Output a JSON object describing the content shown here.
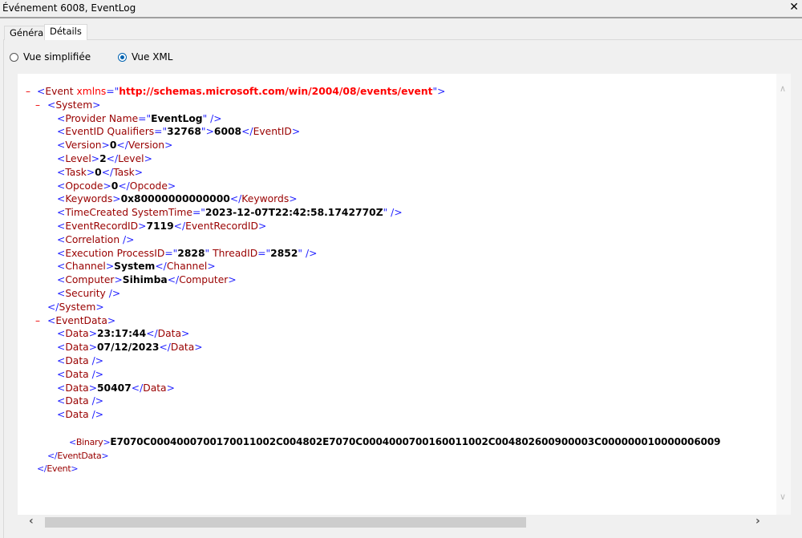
{
  "window": {
    "title": "Événement 6008, EventLog",
    "close_icon": "close-icon"
  },
  "tabs": [
    {
      "label": "Général",
      "active": false
    },
    {
      "label": "Détails",
      "active": true
    }
  ],
  "view_options": [
    {
      "label": "Vue simplifiée",
      "selected": false
    },
    {
      "label": "Vue XML",
      "selected": true
    }
  ],
  "xml": {
    "lines": [
      {
        "indent": 0,
        "collapse": true,
        "tokens": [
          [
            "p",
            "<"
          ],
          [
            "t",
            "Event "
          ],
          [
            "xa",
            "xmlns"
          ],
          [
            "p",
            "=\""
          ],
          [
            "xv",
            "http://schemas.microsoft.com/win/2004/08/events/event"
          ],
          [
            "p",
            "\">"
          ]
        ]
      },
      {
        "indent": 1,
        "collapse": true,
        "tokens": [
          [
            "p",
            "<"
          ],
          [
            "t",
            "System"
          ],
          [
            "p",
            ">"
          ]
        ]
      },
      {
        "indent": 2,
        "tokens": [
          [
            "p",
            "<"
          ],
          [
            "t",
            "Provider "
          ],
          [
            "a",
            "Name"
          ],
          [
            "p",
            "=\""
          ],
          [
            "v",
            "EventLog"
          ],
          [
            "p",
            "\" />"
          ]
        ]
      },
      {
        "indent": 2,
        "tokens": [
          [
            "p",
            "<"
          ],
          [
            "t",
            "EventID "
          ],
          [
            "a",
            "Qualifiers"
          ],
          [
            "p",
            "=\""
          ],
          [
            "v",
            "32768"
          ],
          [
            "p",
            "\">"
          ],
          [
            "x",
            "6008"
          ],
          [
            "p",
            "</"
          ],
          [
            "t",
            "EventID"
          ],
          [
            "p",
            ">"
          ]
        ]
      },
      {
        "indent": 2,
        "tokens": [
          [
            "p",
            "<"
          ],
          [
            "t",
            "Version"
          ],
          [
            "p",
            ">"
          ],
          [
            "x",
            "0"
          ],
          [
            "p",
            "</"
          ],
          [
            "t",
            "Version"
          ],
          [
            "p",
            ">"
          ]
        ]
      },
      {
        "indent": 2,
        "tokens": [
          [
            "p",
            "<"
          ],
          [
            "t",
            "Level"
          ],
          [
            "p",
            ">"
          ],
          [
            "x",
            "2"
          ],
          [
            "p",
            "</"
          ],
          [
            "t",
            "Level"
          ],
          [
            "p",
            ">"
          ]
        ]
      },
      {
        "indent": 2,
        "tokens": [
          [
            "p",
            "<"
          ],
          [
            "t",
            "Task"
          ],
          [
            "p",
            ">"
          ],
          [
            "x",
            "0"
          ],
          [
            "p",
            "</"
          ],
          [
            "t",
            "Task"
          ],
          [
            "p",
            ">"
          ]
        ]
      },
      {
        "indent": 2,
        "tokens": [
          [
            "p",
            "<"
          ],
          [
            "t",
            "Opcode"
          ],
          [
            "p",
            ">"
          ],
          [
            "x",
            "0"
          ],
          [
            "p",
            "</"
          ],
          [
            "t",
            "Opcode"
          ],
          [
            "p",
            ">"
          ]
        ]
      },
      {
        "indent": 2,
        "tokens": [
          [
            "p",
            "<"
          ],
          [
            "t",
            "Keywords"
          ],
          [
            "p",
            ">"
          ],
          [
            "x",
            "0x80000000000000"
          ],
          [
            "p",
            "</"
          ],
          [
            "t",
            "Keywords"
          ],
          [
            "p",
            ">"
          ]
        ]
      },
      {
        "indent": 2,
        "tokens": [
          [
            "p",
            "<"
          ],
          [
            "t",
            "TimeCreated "
          ],
          [
            "a",
            "SystemTime"
          ],
          [
            "p",
            "=\""
          ],
          [
            "v",
            "2023-12-07T22:42:58.1742770Z"
          ],
          [
            "p",
            "\" />"
          ]
        ]
      },
      {
        "indent": 2,
        "tokens": [
          [
            "p",
            "<"
          ],
          [
            "t",
            "EventRecordID"
          ],
          [
            "p",
            ">"
          ],
          [
            "x",
            "7119"
          ],
          [
            "p",
            "</"
          ],
          [
            "t",
            "EventRecordID"
          ],
          [
            "p",
            ">"
          ]
        ]
      },
      {
        "indent": 2,
        "tokens": [
          [
            "p",
            "<"
          ],
          [
            "t",
            "Correlation "
          ],
          [
            "p",
            "/>"
          ]
        ]
      },
      {
        "indent": 2,
        "tokens": [
          [
            "p",
            "<"
          ],
          [
            "t",
            "Execution "
          ],
          [
            "a",
            "ProcessID"
          ],
          [
            "p",
            "=\""
          ],
          [
            "v",
            "2828"
          ],
          [
            "p",
            "\" "
          ],
          [
            "a",
            "ThreadID"
          ],
          [
            "p",
            "=\""
          ],
          [
            "v",
            "2852"
          ],
          [
            "p",
            "\" />"
          ]
        ]
      },
      {
        "indent": 2,
        "tokens": [
          [
            "p",
            "<"
          ],
          [
            "t",
            "Channel"
          ],
          [
            "p",
            ">"
          ],
          [
            "x",
            "System"
          ],
          [
            "p",
            "</"
          ],
          [
            "t",
            "Channel"
          ],
          [
            "p",
            ">"
          ]
        ]
      },
      {
        "indent": 2,
        "tokens": [
          [
            "p",
            "<"
          ],
          [
            "t",
            "Computer"
          ],
          [
            "p",
            ">"
          ],
          [
            "x",
            "Sihimba"
          ],
          [
            "p",
            "</"
          ],
          [
            "t",
            "Computer"
          ],
          [
            "p",
            ">"
          ]
        ]
      },
      {
        "indent": 2,
        "tokens": [
          [
            "p",
            "<"
          ],
          [
            "t",
            "Security "
          ],
          [
            "p",
            "/>"
          ]
        ]
      },
      {
        "indent": 1,
        "tokens": [
          [
            "p",
            "</"
          ],
          [
            "t",
            "System"
          ],
          [
            "p",
            ">"
          ]
        ]
      },
      {
        "indent": 1,
        "collapse": true,
        "tokens": [
          [
            "p",
            "<"
          ],
          [
            "t",
            "EventData"
          ],
          [
            "p",
            ">"
          ]
        ]
      },
      {
        "indent": 2,
        "tokens": [
          [
            "p",
            "<"
          ],
          [
            "t",
            "Data"
          ],
          [
            "p",
            ">"
          ],
          [
            "x",
            "23:17:44"
          ],
          [
            "p",
            "</"
          ],
          [
            "t",
            "Data"
          ],
          [
            "p",
            ">"
          ]
        ]
      },
      {
        "indent": 2,
        "tokens": [
          [
            "p",
            "<"
          ],
          [
            "t",
            "Data"
          ],
          [
            "p",
            ">"
          ],
          [
            "x",
            "07/12/2023"
          ],
          [
            "p",
            "</"
          ],
          [
            "t",
            "Data"
          ],
          [
            "p",
            ">"
          ]
        ]
      },
      {
        "indent": 2,
        "tokens": [
          [
            "p",
            "<"
          ],
          [
            "t",
            "Data "
          ],
          [
            "p",
            "/>"
          ]
        ]
      },
      {
        "indent": 2,
        "tokens": [
          [
            "p",
            "<"
          ],
          [
            "t",
            "Data "
          ],
          [
            "p",
            "/>"
          ]
        ]
      },
      {
        "indent": 2,
        "tokens": [
          [
            "p",
            "<"
          ],
          [
            "t",
            "Data"
          ],
          [
            "p",
            ">"
          ],
          [
            "x",
            "50407"
          ],
          [
            "p",
            "</"
          ],
          [
            "t",
            "Data"
          ],
          [
            "p",
            ">"
          ]
        ]
      },
      {
        "indent": 2,
        "tokens": [
          [
            "p",
            "<"
          ],
          [
            "t",
            "Data "
          ],
          [
            "p",
            "/>"
          ]
        ]
      },
      {
        "indent": 2,
        "tokens": [
          [
            "p",
            "<"
          ],
          [
            "t",
            "Data "
          ],
          [
            "p",
            "/>"
          ]
        ]
      },
      {
        "indent": 2,
        "tokens": []
      },
      {
        "indent": 3,
        "small": true,
        "tokens": [
          [
            "p",
            "<"
          ],
          [
            "t",
            "Binary"
          ],
          [
            "p",
            ">"
          ],
          [
            "x",
            "E7070C0004000700170011002C004802E7070C0004000700160011002C004802600900003C000000010000006009"
          ]
        ]
      },
      {
        "indent": 1,
        "small": true,
        "tokens": [
          [
            "p",
            "</"
          ],
          [
            "t",
            "EventData"
          ],
          [
            "p",
            ">"
          ]
        ]
      },
      {
        "indent": 0,
        "small": true,
        "tokens": [
          [
            "p",
            "</"
          ],
          [
            "t",
            "Event"
          ],
          [
            "p",
            ">"
          ]
        ]
      }
    ]
  },
  "colors": {
    "tag_bracket": "#2222ff",
    "tag_name": "#990000",
    "namespace": "#ff0000",
    "collapse": "#ee0000",
    "radio_accent": "#0063b1"
  }
}
